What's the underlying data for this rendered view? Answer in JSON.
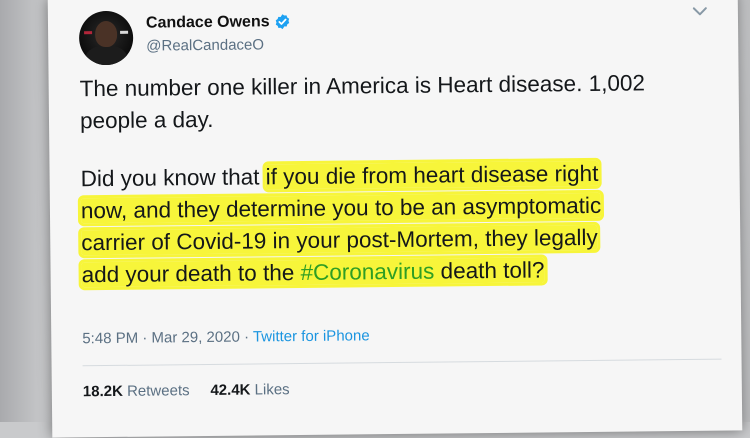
{
  "tweet": {
    "author_name": "Candace Owens",
    "handle": "@RealCandaceO",
    "verified_icon": "verified-badge-icon",
    "menu_icon": "chevron-down-icon",
    "paragraph1": {
      "line1": "The number one killer in America is Heart disease. 1,002",
      "line2": "people a day."
    },
    "paragraph2": {
      "line1_plain": "Did you know that ",
      "line1_hl": "if you die from heart disease right",
      "line2_hl": "now, and they determine you to be an asymptomatic",
      "line3_hl": "carrier of Covid-19 in your post-Mortem, they legally",
      "line4_hl_before": "add your death to the ",
      "line4_hashtag": "#Coronavirus",
      "line4_hl_after": " death toll?"
    },
    "timestamp": "5:48 PM · Mar 29, 2020 · ",
    "source": "Twitter for iPhone",
    "retweets_count": "18.2K",
    "retweets_label": "Retweets",
    "likes_count": "42.4K",
    "likes_label": "Likes"
  },
  "colors": {
    "highlight": "#f7f53a",
    "hashtag": "#2e9e24",
    "link": "#1b95e0",
    "verified": "#1da1f2",
    "secondary_text": "#5b7083"
  }
}
